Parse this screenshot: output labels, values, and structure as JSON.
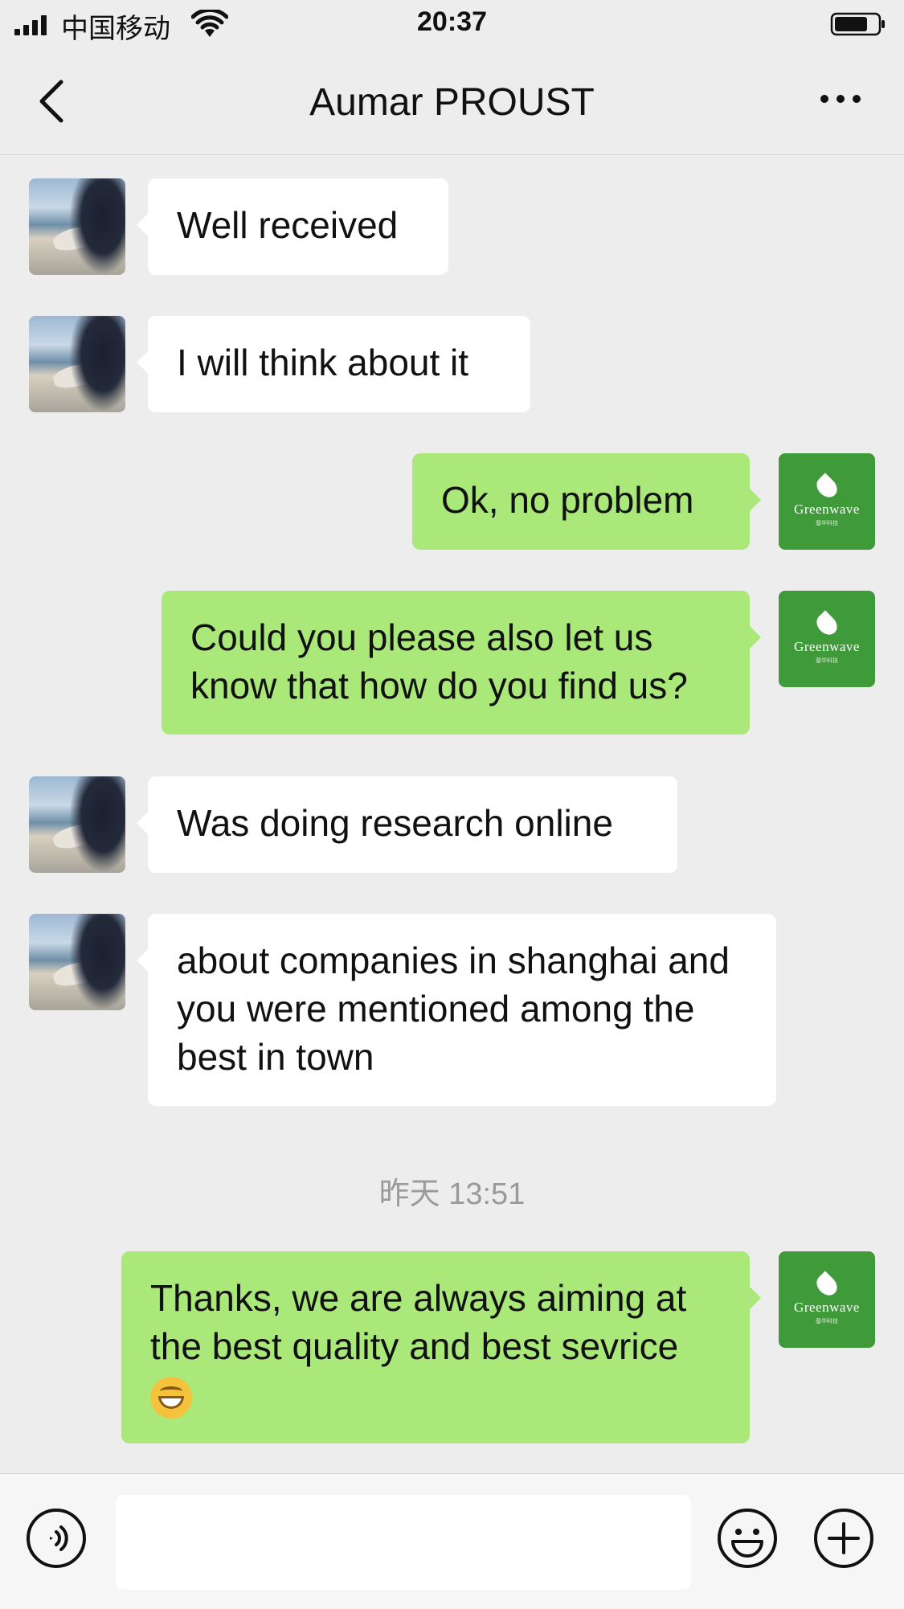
{
  "status_bar": {
    "carrier": "中国移动",
    "time": "20:37"
  },
  "header": {
    "title": "Aumar PROUST"
  },
  "messages": [
    {
      "side": "in",
      "text": "Well received"
    },
    {
      "side": "in",
      "text": "I will think about it"
    },
    {
      "side": "out",
      "text": "Ok, no problem"
    },
    {
      "side": "out",
      "text": "Could you please also let us know that how do you find us?"
    },
    {
      "side": "in",
      "text": "Was doing research online"
    },
    {
      "side": "in",
      "text": "about companies in shanghai and you were mentioned among the best in town"
    },
    {
      "side": "out",
      "text": "Thanks, we are always aiming at the best quality and best sevrice"
    }
  ],
  "timestamp": "昨天 13:51",
  "brand_avatar": {
    "name": "Greenwave",
    "sub": "基华科技"
  },
  "colors": {
    "background": "#ededed",
    "outgoing_bubble": "#a9e879",
    "incoming_bubble": "#ffffff",
    "brand_green": "#3f9b3a"
  },
  "icons": [
    "back-icon",
    "more-icon",
    "voice-icon",
    "emoji-icon",
    "plus-icon",
    "grin-emoji-icon"
  ]
}
